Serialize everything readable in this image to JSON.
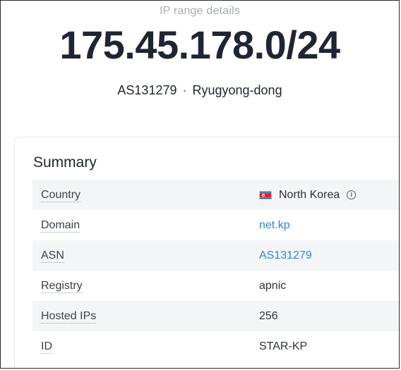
{
  "header": {
    "subtitle": "IP range details",
    "range": "175.45.178.0/24",
    "asn": "AS131279",
    "separator": "·",
    "location": "Ryugyong-dong"
  },
  "summary": {
    "title": "Summary",
    "rows": [
      {
        "label": "Country",
        "value": "North Korea",
        "flag": "north-korea-flag",
        "info_icon": "info-icon"
      },
      {
        "label": "Domain",
        "value": "net.kp"
      },
      {
        "label": "ASN",
        "value": "AS131279"
      },
      {
        "label": "Registry",
        "value": "apnic"
      },
      {
        "label": "Hosted IPs",
        "value": "256"
      },
      {
        "label": "ID",
        "value": "STAR-KP"
      }
    ]
  },
  "colors": {
    "text": "#1f2532",
    "link": "#2f86d6",
    "muted": "#a6acb6",
    "row_stripe": "#f4f5f7"
  }
}
